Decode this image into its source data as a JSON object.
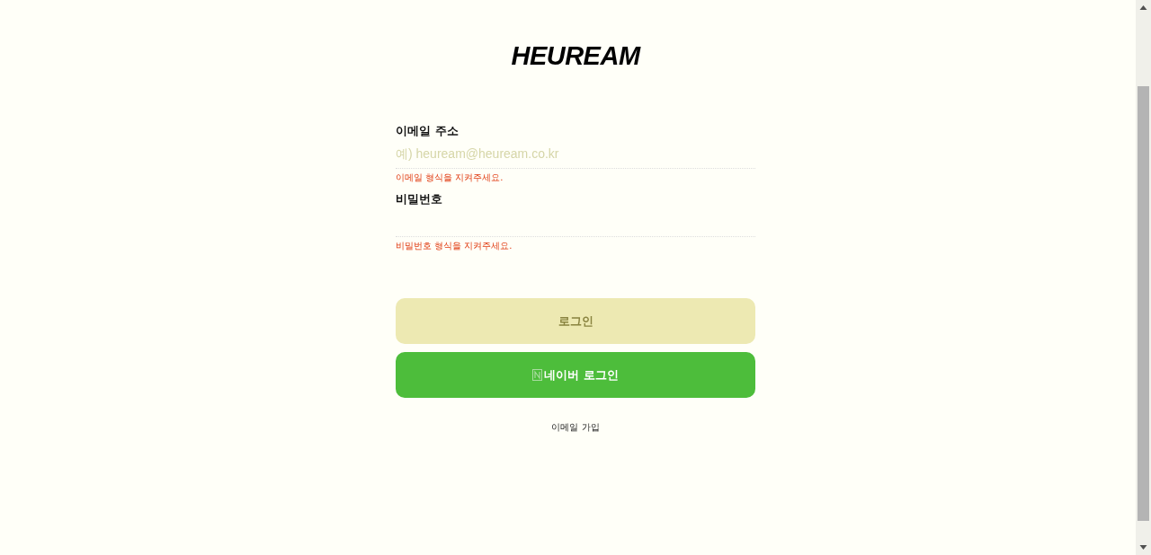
{
  "logo": "HEUREAM",
  "fields": [
    {
      "label": "이메일 주소",
      "placeholder": "예) heuream@heuream.co.kr",
      "error": "이메일 형식을 지켜주세요."
    },
    {
      "label": "비밀번호",
      "error": "비밀번호 형식을 지켜주세요."
    }
  ],
  "login_button": {
    "label": "로그인",
    "disabled": true
  },
  "naver_button": {
    "label": "네이버 로그인"
  },
  "signup_link": "이메일 가입"
}
